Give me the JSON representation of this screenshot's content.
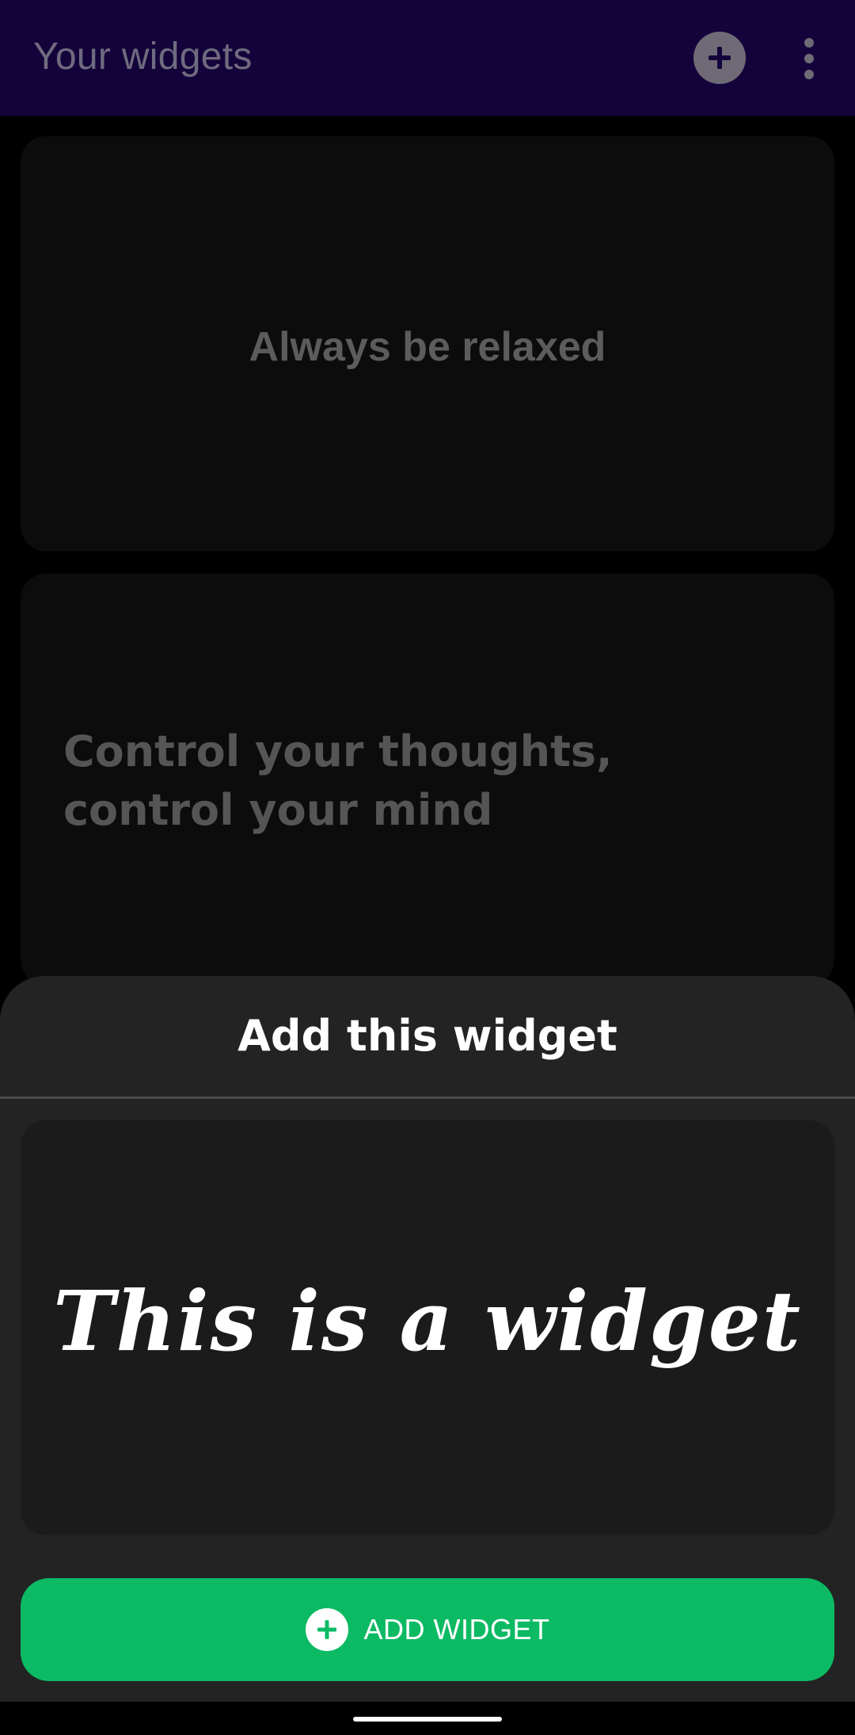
{
  "appbar": {
    "title": "Your widgets",
    "add_icon": "plus-circle-icon",
    "menu_icon": "more-vertical-icon"
  },
  "widgets": [
    {
      "text": "Always be relaxed"
    },
    {
      "text": "Control your thoughts, control your mind"
    }
  ],
  "sheet": {
    "title": "Add this widget",
    "preview_text": "This is a widget",
    "button_label": "ADD WIDGET",
    "button_icon": "plus-circle-icon"
  },
  "colors": {
    "appbar_bg": "#14033b",
    "sheet_bg": "#232323",
    "accent_green": "#0bba63"
  }
}
